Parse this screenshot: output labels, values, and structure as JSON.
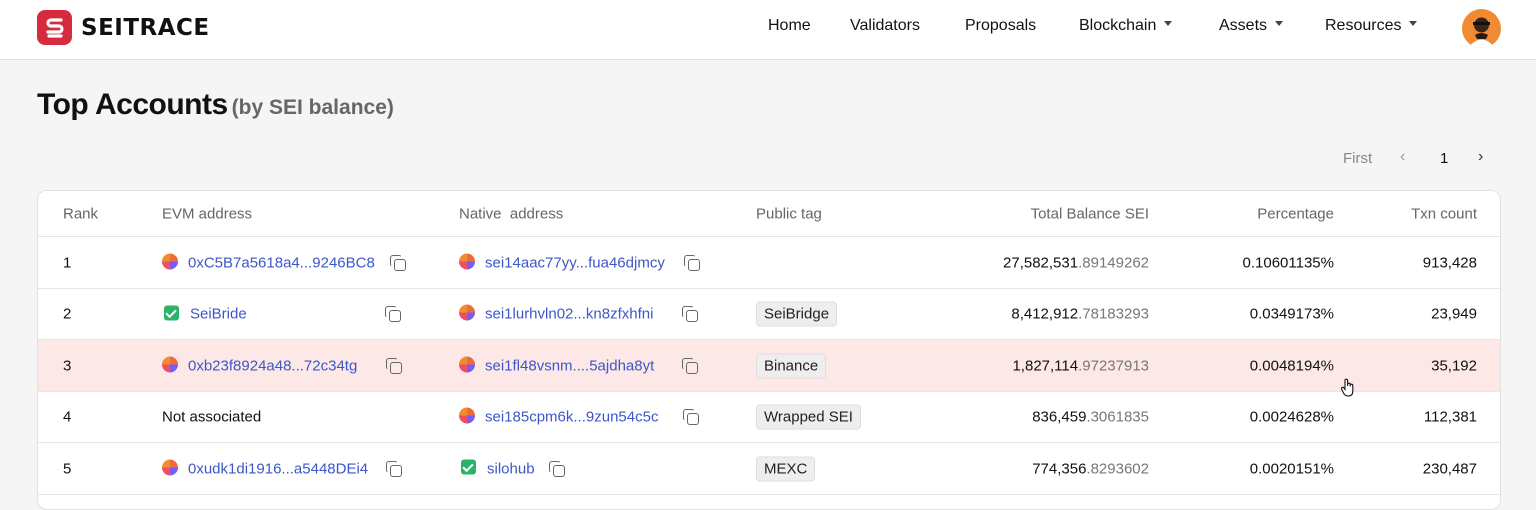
{
  "header": {
    "logo_text": "SEITRACE",
    "nav": [
      {
        "label": "Home",
        "dropdown": false
      },
      {
        "label": "Validators",
        "dropdown": false
      },
      {
        "label": "Proposals",
        "dropdown": false
      },
      {
        "label": "Blockchain",
        "dropdown": true
      },
      {
        "label": "Assets",
        "dropdown": true
      },
      {
        "label": "Resources",
        "dropdown": true
      }
    ]
  },
  "page": {
    "title": "Top Accounts",
    "subtitle": "(by SEI balance)"
  },
  "pagination": {
    "first_label": "First",
    "current_page": "1"
  },
  "table": {
    "columns": [
      "Rank",
      "EVM address",
      "Native  address",
      "Public tag",
      "Total Balance SEI",
      "Percentage",
      "Txn count"
    ],
    "rows": [
      {
        "rank": "1",
        "evm": "0xC5B7a5618a4...9246BC8",
        "evm_icon": "token-dot-icon",
        "evm_link": true,
        "native": "sei14aac77yy...fua46djmcy",
        "native_icon": "token-dot-icon",
        "tag": "",
        "balance_int": "27,582,531",
        "balance_dec": ".89149262",
        "percentage": "0.10601135%",
        "txn": "913,428",
        "highlight": false
      },
      {
        "rank": "2",
        "evm": "SeiBride",
        "evm_icon": "verified-contract-icon",
        "evm_link": true,
        "native": "sei1lurhvln02...kn8zfxhfni",
        "native_icon": "token-dot-icon",
        "tag": "SeiBridge",
        "balance_int": "8,412,912",
        "balance_dec": ".78183293",
        "percentage": "0.0349173%",
        "txn": "23,949",
        "highlight": false
      },
      {
        "rank": "3",
        "evm": "0xb23f8924a48...72c34tg",
        "evm_icon": "token-dot-icon",
        "evm_link": true,
        "native": "sei1fl48vsnm....5ajdha8yt",
        "native_icon": "token-dot-icon",
        "tag": "Binance",
        "balance_int": "1,827,114",
        "balance_dec": ".97237913",
        "percentage": "0.0048194%",
        "txn": "35,192",
        "highlight": true
      },
      {
        "rank": "4",
        "evm": "Not associated",
        "evm_icon": "",
        "evm_link": false,
        "native": "sei185cpm6k...9zun54c5c",
        "native_icon": "token-dot-icon",
        "tag": "Wrapped SEI",
        "balance_int": "836,459",
        "balance_dec": ".3061835",
        "percentage": "0.0024628%",
        "txn": "112,381",
        "highlight": false
      },
      {
        "rank": "5",
        "evm": "0xudk1di1916...a5448DEi4",
        "evm_icon": "token-dot-icon",
        "evm_link": true,
        "native": "silohub",
        "native_icon": "verified-contract-icon",
        "tag": "MEXC",
        "balance_int": "774,356",
        "balance_dec": ".8293602",
        "percentage": "0.0020151%",
        "txn": "230,487",
        "highlight": false
      }
    ]
  },
  "colors": {
    "brand": "#d62b3f",
    "link": "#3c57c9",
    "highlight_row": "#fde8e8",
    "verified_icon": "#29b469"
  }
}
